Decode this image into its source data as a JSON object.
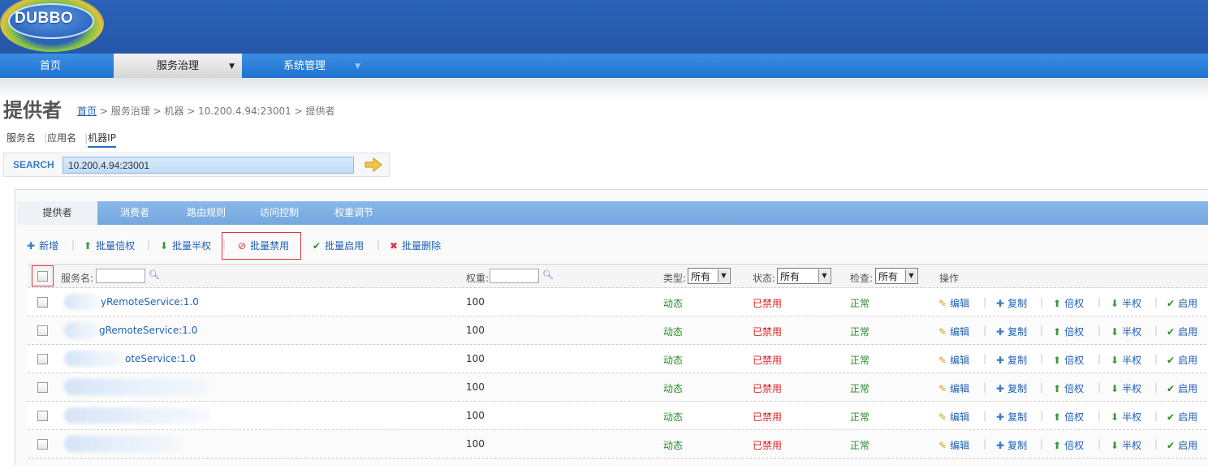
{
  "logo": {
    "text": "DUBBO"
  },
  "nav": {
    "home": "首页",
    "governance": "服务治理",
    "governance_caret": "▼",
    "system": "系统管理",
    "system_caret": "▼"
  },
  "page": {
    "title": "提供者",
    "breadcrumb": {
      "home": "首页",
      "rest": " > 服务治理 > 机器 > 10.200.4.94:23001 > 提供者"
    }
  },
  "search_tabs": {
    "service": "服务名",
    "app": "应用名",
    "ip": "机器IP",
    "active": "机器IP"
  },
  "search": {
    "label": "SEARCH",
    "value": "10.200.4.94:23001"
  },
  "tabs": [
    "提供者",
    "消费者",
    "路由规则",
    "访问控制",
    "权重调节"
  ],
  "toolbar": {
    "add": "新增",
    "double": "批量倍权",
    "half": "批量半权",
    "disable": "批量禁用",
    "enable": "批量启用",
    "delete": "批量删除"
  },
  "table": {
    "headers": {
      "service": "服务名:",
      "weight": "权重:",
      "type": "类型:",
      "type_value": "所有",
      "status": "状态:",
      "status_value": "所有",
      "check": "检查:",
      "check_value": "所有",
      "ops": "操作"
    },
    "rows": [
      {
        "service": "yRemoteService:1.0",
        "weight": "100",
        "type": "动态",
        "status": "已禁用",
        "check": "正常"
      },
      {
        "service": "gRemoteService:1.0",
        "weight": "100",
        "type": "动态",
        "status": "已禁用",
        "check": "正常"
      },
      {
        "service": "oteService:1.0",
        "weight": "100",
        "type": "动态",
        "status": "已禁用",
        "check": "正常"
      },
      {
        "service": "",
        "weight": "100",
        "type": "动态",
        "status": "已禁用",
        "check": "正常"
      },
      {
        "service": "",
        "weight": "100",
        "type": "动态",
        "status": "已禁用",
        "check": "正常"
      },
      {
        "service": "",
        "weight": "100",
        "type": "动态",
        "status": "已禁用",
        "check": "正常"
      }
    ],
    "ops": {
      "edit": "编辑",
      "copy": "复制",
      "double": "倍权",
      "half": "半权",
      "enable": "启用"
    }
  },
  "colors": {
    "header": "#2a63b8",
    "nav": "#2b7fd9",
    "link": "#1f5fb7",
    "highlight": "#d9363e",
    "ok": "#2a8a2a",
    "disabled": "#dd2222"
  }
}
